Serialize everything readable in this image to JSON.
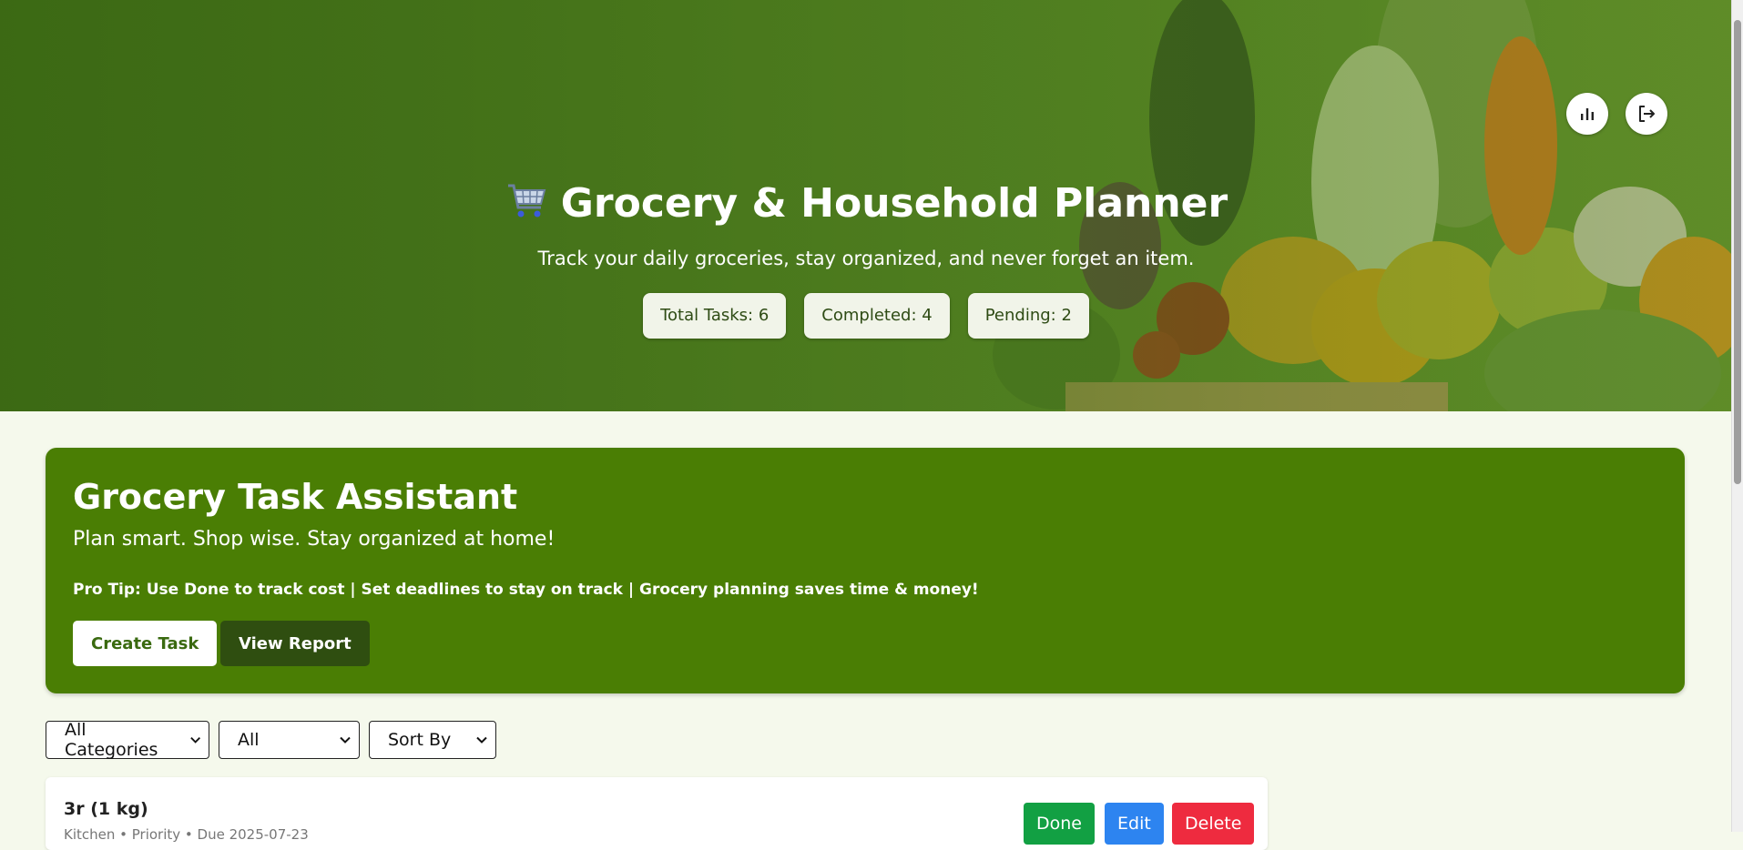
{
  "hero": {
    "title": "Grocery & Household Planner",
    "cart_icon": "shopping-cart-icon",
    "subtitle": "Track your daily groceries, stay organized, and never forget an item.",
    "stats": {
      "total": "Total Tasks: 6",
      "completed": "Completed: 4",
      "pending": "Pending: 2"
    },
    "actions": {
      "chart_icon": "bar-chart-icon",
      "logout_icon": "logout-icon"
    }
  },
  "assistant": {
    "title": "Grocery Task Assistant",
    "subtitle": "Plan smart. Shop wise. Stay organized at home!",
    "tip": "Pro Tip: Use Done to track cost | Set deadlines to stay on track | Grocery planning saves time & money!",
    "create_label": "Create Task",
    "report_label": "View Report"
  },
  "filters": {
    "category": "All Categories",
    "status": "All",
    "sort": "Sort By"
  },
  "tasks": [
    {
      "title": "3r (1 kg)",
      "meta": "Kitchen • Priority • Due 2025-07-23",
      "done_label": "Done",
      "edit_label": "Edit",
      "delete_label": "Delete"
    }
  ],
  "colors": {
    "hero_green": "#4d7e20",
    "assistant_green": "#4a7e04",
    "page_bg": "#f5f9ec",
    "done": "#12a043",
    "edit": "#2d84f0",
    "delete": "#ee2b3f"
  }
}
